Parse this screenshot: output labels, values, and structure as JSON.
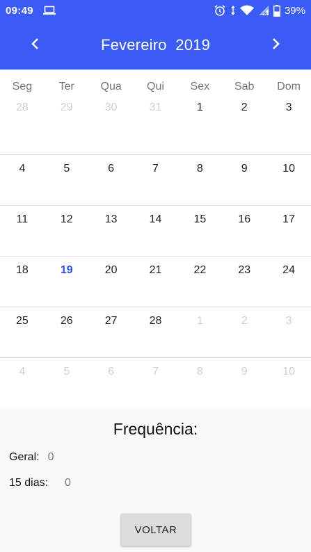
{
  "status_bar": {
    "time": "09:49",
    "battery": "39%",
    "icons": [
      "laptop-icon",
      "alarm-icon",
      "data-arrows-icon",
      "wifi-icon",
      "signal-icon",
      "battery-icon"
    ]
  },
  "header": {
    "title": "Fevereiro  2019",
    "prev_icon": "chevron-left-icon",
    "next_icon": "chevron-right-icon",
    "color": "#3b5bf5"
  },
  "calendar": {
    "weekdays": [
      "Seg",
      "Ter",
      "Qua",
      "Qui",
      "Sex",
      "Sab",
      "Dom"
    ],
    "weeks": [
      [
        {
          "d": "28",
          "o": true
        },
        {
          "d": "29",
          "o": true
        },
        {
          "d": "30",
          "o": true
        },
        {
          "d": "31",
          "o": true
        },
        {
          "d": "1"
        },
        {
          "d": "2"
        },
        {
          "d": "3"
        }
      ],
      [
        {
          "d": "4"
        },
        {
          "d": "5"
        },
        {
          "d": "6"
        },
        {
          "d": "7"
        },
        {
          "d": "8"
        },
        {
          "d": "9"
        },
        {
          "d": "10"
        }
      ],
      [
        {
          "d": "11"
        },
        {
          "d": "12"
        },
        {
          "d": "13"
        },
        {
          "d": "14"
        },
        {
          "d": "15"
        },
        {
          "d": "16"
        },
        {
          "d": "17"
        }
      ],
      [
        {
          "d": "18"
        },
        {
          "d": "19",
          "t": true
        },
        {
          "d": "20"
        },
        {
          "d": "21"
        },
        {
          "d": "22"
        },
        {
          "d": "23"
        },
        {
          "d": "24"
        }
      ],
      [
        {
          "d": "25"
        },
        {
          "d": "26"
        },
        {
          "d": "27"
        },
        {
          "d": "28"
        },
        {
          "d": "1",
          "o": true
        },
        {
          "d": "2",
          "o": true
        },
        {
          "d": "3",
          "o": true
        }
      ],
      [
        {
          "d": "4",
          "o": true
        },
        {
          "d": "5",
          "o": true
        },
        {
          "d": "6",
          "o": true
        },
        {
          "d": "7",
          "o": true
        },
        {
          "d": "8",
          "o": true
        },
        {
          "d": "9",
          "o": true
        },
        {
          "d": "10",
          "o": true
        }
      ]
    ],
    "today_color": "#2a4ff0"
  },
  "frequencia": {
    "title": "Frequência:",
    "geral_label": "Geral:",
    "geral_value": "0",
    "dias15_label": "15 dias:",
    "dias15_value": "0"
  },
  "voltar_label": "VOLTAR"
}
